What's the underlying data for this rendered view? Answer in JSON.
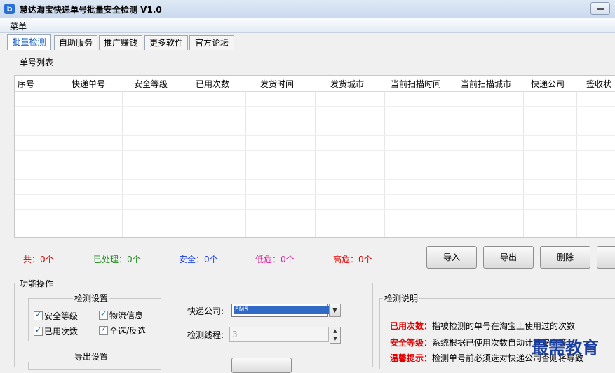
{
  "window": {
    "title": "慧达淘宝快递单号批量安全检测 V1.0",
    "icon_letter": "b"
  },
  "menu": {
    "label": "菜单"
  },
  "tabs": [
    "批量检测",
    "自助服务",
    "推广赚钱",
    "更多软件",
    "官方论坛"
  ],
  "list_group": {
    "title": "单号列表"
  },
  "columns": [
    "序号",
    "快递单号",
    "安全等级",
    "已用次数",
    "发货时间",
    "发货城市",
    "当前扫描时间",
    "当前扫描城市",
    "快递公司",
    "签收状"
  ],
  "rows": [],
  "stats": {
    "total": "共：0个",
    "processed": "已处理：0个",
    "safe": "安全：0个",
    "low_risk": "低危：0个",
    "high_risk": "高危：0个"
  },
  "buttons": {
    "import": "导入",
    "export": "导出",
    "delete": "删除"
  },
  "ops": {
    "title": "功能操作",
    "detect_settings": "检测设置",
    "export_settings": "导出设置",
    "checkboxes": [
      "安全等级",
      "物流信息",
      "已用次数",
      "全选/反选"
    ],
    "courier_label": "快递公司:",
    "courier_value": "EMS",
    "threads_label": "检测线程:",
    "threads_value": "3"
  },
  "description": {
    "title": "检测说明",
    "lines": [
      {
        "key": "已用次数：",
        "text": "指被检测的单号在淘宝上使用过的次数"
      },
      {
        "key": "安全等级：",
        "text": "系统根据已使用次数自动计算安全等"
      },
      {
        "key": "温馨提示：",
        "text": "检测单号前必须选对快递公司否则将导致"
      }
    ]
  },
  "watermark": "最需教育",
  "colors": {
    "processed": "#1a8a1a",
    "safe": "#1a3ee0",
    "low_risk": "#e0229a",
    "high_risk": "#e00000",
    "total": "#d00000",
    "desc_key": "#e00000"
  }
}
